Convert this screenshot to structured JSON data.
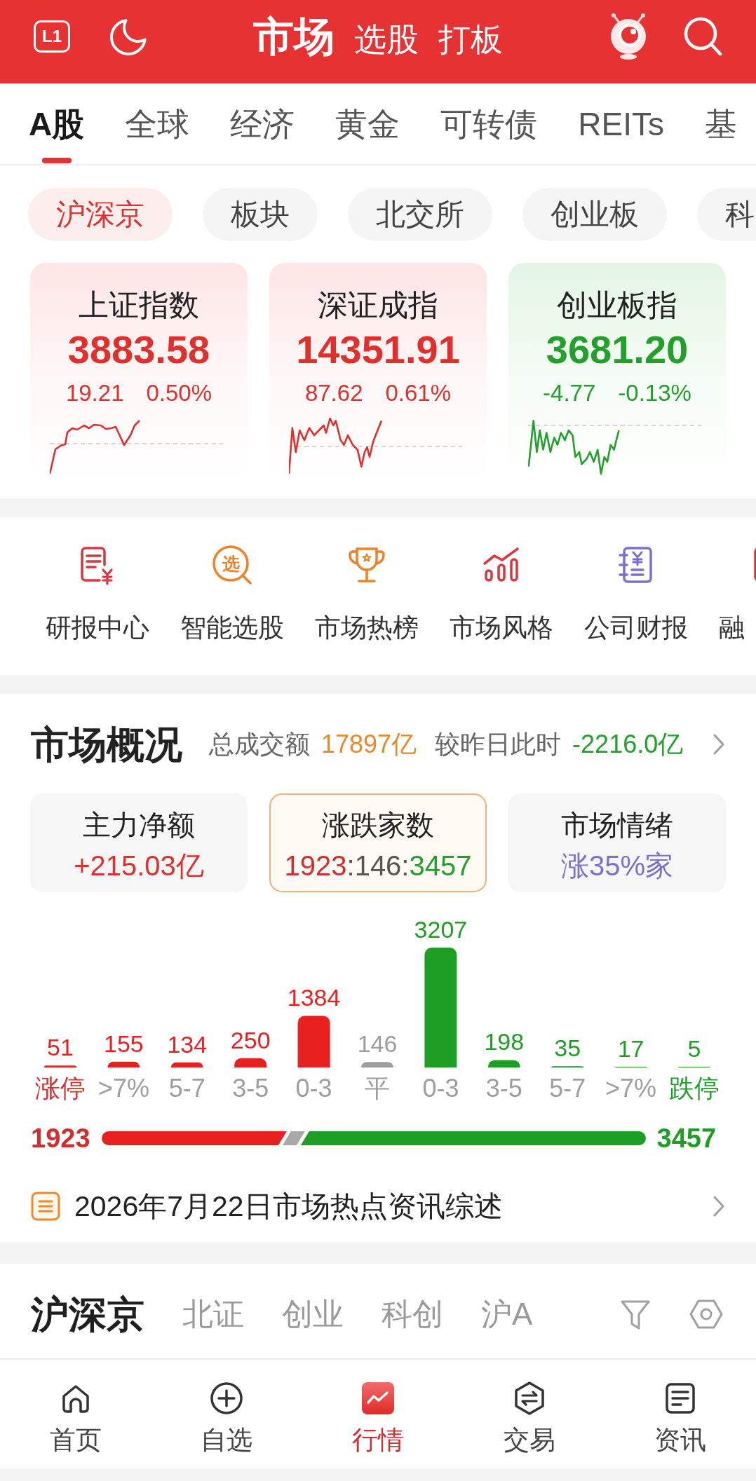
{
  "header": {
    "level_button": "L1",
    "tabs": [
      {
        "label": "市场",
        "selected": true
      },
      {
        "label": "选股",
        "selected": false
      },
      {
        "label": "打板",
        "selected": false
      }
    ]
  },
  "market_tabs": [
    {
      "label": "A股",
      "selected": true
    },
    {
      "label": "全球",
      "selected": false
    },
    {
      "label": "经济",
      "selected": false
    },
    {
      "label": "黄金",
      "selected": false
    },
    {
      "label": "可转债",
      "selected": false
    },
    {
      "label": "REITs",
      "selected": false
    },
    {
      "label": "基",
      "selected": false
    }
  ],
  "board_chips": [
    {
      "label": "沪深京",
      "selected": true
    },
    {
      "label": "板块",
      "selected": false
    },
    {
      "label": "北交所",
      "selected": false
    },
    {
      "label": "创业板",
      "selected": false
    },
    {
      "label": "科",
      "selected": false
    }
  ],
  "index_cards": [
    {
      "name": "上证指数",
      "value": "3883.58",
      "change": "19.21",
      "change_percent": "0.50%",
      "rising": true
    },
    {
      "name": "深证成指",
      "value": "14351.91",
      "change": "87.62",
      "change_percent": "0.61%",
      "rising": true
    },
    {
      "name": "创业板指",
      "value": "3681.20",
      "change": "-4.77",
      "change_percent": "-0.13%",
      "rising": false
    }
  ],
  "shortcuts": [
    {
      "label": "研报中心",
      "kind": "report"
    },
    {
      "label": "智能选股",
      "kind": "picker",
      "badge": "选"
    },
    {
      "label": "市场热榜",
      "kind": "trophy"
    },
    {
      "label": "市场风格",
      "kind": "style"
    },
    {
      "label": "公司财报",
      "kind": "financials"
    },
    {
      "label": "融",
      "kind": "report"
    }
  ],
  "market_overview": {
    "title": "市场概况",
    "summary": [
      {
        "label": "总成交额",
        "value": "17897亿",
        "color": "#e8892e"
      },
      {
        "label": "较昨日此时",
        "value": "-2216.0亿",
        "color": "#23a02b"
      }
    ],
    "stat_cards": [
      {
        "title": "主力净额",
        "value_parts": [
          {
            "text": "+215.03亿",
            "color": "#e0302e"
          }
        ],
        "selected": false
      },
      {
        "title": "涨跌家数",
        "value_parts": [
          {
            "text": "1923",
            "color": "#d12f2d"
          },
          {
            "text": ":146:",
            "color": "#555555"
          },
          {
            "text": "3457",
            "color": "#23a02b"
          }
        ],
        "selected": true
      },
      {
        "title": "市场情绪",
        "value_parts": [
          {
            "text": "涨35%家",
            "color": "#7b6fcf"
          }
        ],
        "selected": false
      }
    ],
    "distribution": {
      "chart_data": {
        "type": "bar",
        "categories": [
          "涨停",
          ">7%",
          "5-7",
          "3-5",
          "0-3",
          "平",
          "0-3",
          "3-5",
          "5-7",
          ">7%",
          "跌停"
        ],
        "series": [
          {
            "color": "#e8211f",
            "values": [
              51,
              155,
              134,
              250,
              1384,
              null,
              null,
              null,
              null,
              null,
              null
            ]
          },
          {
            "color": "#9e9e9e",
            "values": [
              null,
              null,
              null,
              null,
              null,
              146,
              null,
              null,
              null,
              null,
              null
            ]
          },
          {
            "color": "#1f9e26",
            "values": [
              null,
              null,
              null,
              null,
              null,
              null,
              3207,
              198,
              35,
              17,
              5
            ]
          }
        ],
        "stacked": true,
        "data_labels": true
      },
      "category_styles": [
        {
          "color": "#d62f2d"
        },
        {
          "color": "#9e9e9e"
        },
        {
          "color": "#9e9e9e"
        },
        {
          "color": "#9e9e9e"
        },
        {
          "color": "#9e9e9e"
        },
        {
          "color": "#9e9e9e"
        },
        {
          "color": "#9e9e9e"
        },
        {
          "color": "#9e9e9e"
        },
        {
          "color": "#9e9e9e"
        },
        {
          "color": "#9e9e9e"
        },
        {
          "color": "#1f9e26"
        }
      ]
    },
    "ratio": {
      "rise": "1923",
      "fall": "3457",
      "level": 0.34
    },
    "news": {
      "title": "2026年7月22日市场热点资讯综述"
    }
  },
  "stock_list": {
    "tabs": [
      {
        "label": "沪深京",
        "selected": true
      },
      {
        "label": "北证",
        "selected": false
      },
      {
        "label": "创业",
        "selected": false
      },
      {
        "label": "科创",
        "selected": false
      },
      {
        "label": "沪A",
        "selected": false
      }
    ]
  },
  "bottom_nav": [
    {
      "label": "首页",
      "kind": "home",
      "selected": false
    },
    {
      "label": "自选",
      "kind": "watchlist",
      "selected": false
    },
    {
      "label": "行情",
      "kind": "market",
      "selected": true
    },
    {
      "label": "交易",
      "kind": "trade",
      "selected": false
    },
    {
      "label": "资讯",
      "kind": "news",
      "selected": false
    }
  ]
}
